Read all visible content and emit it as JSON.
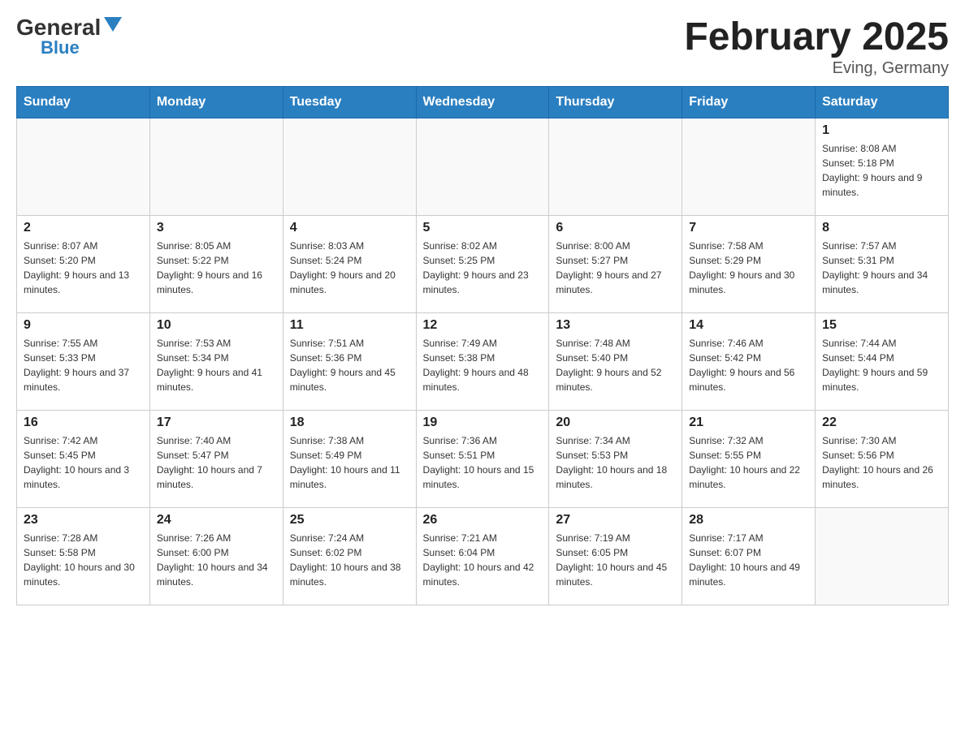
{
  "logo": {
    "general": "General",
    "blue": "Blue"
  },
  "title": "February 2025",
  "location": "Eving, Germany",
  "days_of_week": [
    "Sunday",
    "Monday",
    "Tuesday",
    "Wednesday",
    "Thursday",
    "Friday",
    "Saturday"
  ],
  "weeks": [
    [
      {
        "day": "",
        "info": ""
      },
      {
        "day": "",
        "info": ""
      },
      {
        "day": "",
        "info": ""
      },
      {
        "day": "",
        "info": ""
      },
      {
        "day": "",
        "info": ""
      },
      {
        "day": "",
        "info": ""
      },
      {
        "day": "1",
        "info": "Sunrise: 8:08 AM\nSunset: 5:18 PM\nDaylight: 9 hours and 9 minutes."
      }
    ],
    [
      {
        "day": "2",
        "info": "Sunrise: 8:07 AM\nSunset: 5:20 PM\nDaylight: 9 hours and 13 minutes."
      },
      {
        "day": "3",
        "info": "Sunrise: 8:05 AM\nSunset: 5:22 PM\nDaylight: 9 hours and 16 minutes."
      },
      {
        "day": "4",
        "info": "Sunrise: 8:03 AM\nSunset: 5:24 PM\nDaylight: 9 hours and 20 minutes."
      },
      {
        "day": "5",
        "info": "Sunrise: 8:02 AM\nSunset: 5:25 PM\nDaylight: 9 hours and 23 minutes."
      },
      {
        "day": "6",
        "info": "Sunrise: 8:00 AM\nSunset: 5:27 PM\nDaylight: 9 hours and 27 minutes."
      },
      {
        "day": "7",
        "info": "Sunrise: 7:58 AM\nSunset: 5:29 PM\nDaylight: 9 hours and 30 minutes."
      },
      {
        "day": "8",
        "info": "Sunrise: 7:57 AM\nSunset: 5:31 PM\nDaylight: 9 hours and 34 minutes."
      }
    ],
    [
      {
        "day": "9",
        "info": "Sunrise: 7:55 AM\nSunset: 5:33 PM\nDaylight: 9 hours and 37 minutes."
      },
      {
        "day": "10",
        "info": "Sunrise: 7:53 AM\nSunset: 5:34 PM\nDaylight: 9 hours and 41 minutes."
      },
      {
        "day": "11",
        "info": "Sunrise: 7:51 AM\nSunset: 5:36 PM\nDaylight: 9 hours and 45 minutes."
      },
      {
        "day": "12",
        "info": "Sunrise: 7:49 AM\nSunset: 5:38 PM\nDaylight: 9 hours and 48 minutes."
      },
      {
        "day": "13",
        "info": "Sunrise: 7:48 AM\nSunset: 5:40 PM\nDaylight: 9 hours and 52 minutes."
      },
      {
        "day": "14",
        "info": "Sunrise: 7:46 AM\nSunset: 5:42 PM\nDaylight: 9 hours and 56 minutes."
      },
      {
        "day": "15",
        "info": "Sunrise: 7:44 AM\nSunset: 5:44 PM\nDaylight: 9 hours and 59 minutes."
      }
    ],
    [
      {
        "day": "16",
        "info": "Sunrise: 7:42 AM\nSunset: 5:45 PM\nDaylight: 10 hours and 3 minutes."
      },
      {
        "day": "17",
        "info": "Sunrise: 7:40 AM\nSunset: 5:47 PM\nDaylight: 10 hours and 7 minutes."
      },
      {
        "day": "18",
        "info": "Sunrise: 7:38 AM\nSunset: 5:49 PM\nDaylight: 10 hours and 11 minutes."
      },
      {
        "day": "19",
        "info": "Sunrise: 7:36 AM\nSunset: 5:51 PM\nDaylight: 10 hours and 15 minutes."
      },
      {
        "day": "20",
        "info": "Sunrise: 7:34 AM\nSunset: 5:53 PM\nDaylight: 10 hours and 18 minutes."
      },
      {
        "day": "21",
        "info": "Sunrise: 7:32 AM\nSunset: 5:55 PM\nDaylight: 10 hours and 22 minutes."
      },
      {
        "day": "22",
        "info": "Sunrise: 7:30 AM\nSunset: 5:56 PM\nDaylight: 10 hours and 26 minutes."
      }
    ],
    [
      {
        "day": "23",
        "info": "Sunrise: 7:28 AM\nSunset: 5:58 PM\nDaylight: 10 hours and 30 minutes."
      },
      {
        "day": "24",
        "info": "Sunrise: 7:26 AM\nSunset: 6:00 PM\nDaylight: 10 hours and 34 minutes."
      },
      {
        "day": "25",
        "info": "Sunrise: 7:24 AM\nSunset: 6:02 PM\nDaylight: 10 hours and 38 minutes."
      },
      {
        "day": "26",
        "info": "Sunrise: 7:21 AM\nSunset: 6:04 PM\nDaylight: 10 hours and 42 minutes."
      },
      {
        "day": "27",
        "info": "Sunrise: 7:19 AM\nSunset: 6:05 PM\nDaylight: 10 hours and 45 minutes."
      },
      {
        "day": "28",
        "info": "Sunrise: 7:17 AM\nSunset: 6:07 PM\nDaylight: 10 hours and 49 minutes."
      },
      {
        "day": "",
        "info": ""
      }
    ]
  ]
}
